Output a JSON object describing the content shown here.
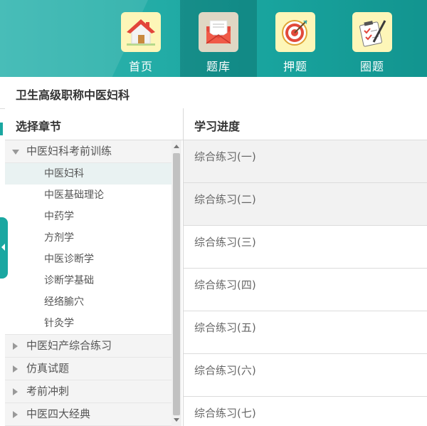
{
  "nav": {
    "items": [
      {
        "label": "首页",
        "icon": "home-icon"
      },
      {
        "label": "题库",
        "icon": "envelope-icon"
      },
      {
        "label": "押题",
        "icon": "target-icon"
      },
      {
        "label": "圈题",
        "icon": "clipboard-icon"
      }
    ],
    "active_index": 1
  },
  "page": {
    "title": "卫生高级职称中医妇科"
  },
  "chapters": {
    "header": "选择章节",
    "groups": [
      {
        "label": "中医妇科考前训练",
        "expanded": true,
        "items": [
          "中医妇科",
          "中医基础理论",
          "中药学",
          "方剂学",
          "中医诊断学",
          "诊断学基础",
          "经络腧穴",
          "针灸学"
        ],
        "selected": "中医妇科"
      },
      {
        "label": "中医妇产综合练习",
        "expanded": false
      },
      {
        "label": "仿真试题",
        "expanded": false
      },
      {
        "label": "考前冲刺",
        "expanded": false
      },
      {
        "label": "中医四大经典",
        "expanded": false
      }
    ]
  },
  "progress": {
    "header": "学习进度",
    "exercises": [
      "综合练习(一)",
      "综合练习(二)",
      "综合练习(三)",
      "综合练习(四)",
      "综合练习(五)",
      "综合练习(六)",
      "综合练习(七)"
    ]
  },
  "colors": {
    "accent": "#1aa7a1",
    "nav_bg": "#26aea8"
  }
}
